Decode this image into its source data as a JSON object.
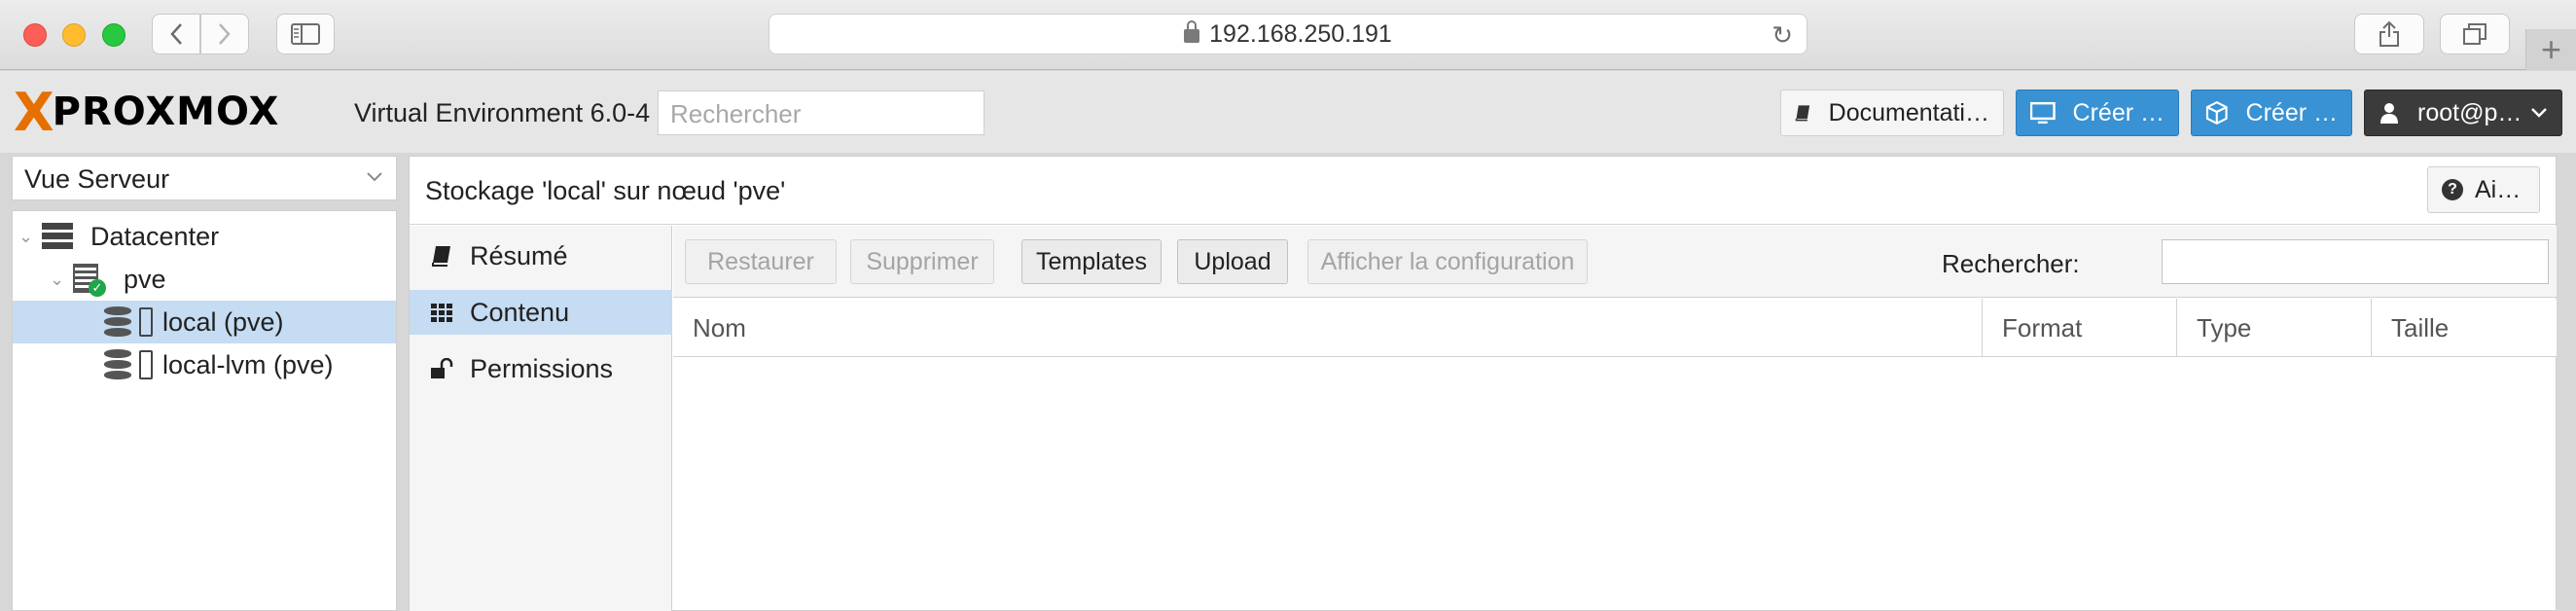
{
  "browser": {
    "url": "192.168.250.191",
    "icons": {
      "back": "chevron-left-icon",
      "forward": "chevron-right-icon",
      "sidebar": "sidebar-icon",
      "reload": "reload-icon",
      "share": "share-icon",
      "tabs": "tabs-icon",
      "new_tab": "plus-icon"
    }
  },
  "header": {
    "logo_prefix": "X",
    "logo_text": "PROXMOX",
    "version": "Virtual Environment 6.0-4",
    "search_placeholder": "Rechercher",
    "buttons": {
      "documentation": "Documentati…",
      "create_vm": "Créer …",
      "create_ct": "Créer …",
      "user": "root@p…"
    }
  },
  "tree": {
    "view_select": "Vue Serveur",
    "nodes": [
      {
        "label": "Datacenter",
        "icon": "datacenter-icon"
      },
      {
        "label": "pve",
        "icon": "node-icon"
      },
      {
        "label": "local (pve)",
        "icon": "storage-icon",
        "selected": true
      },
      {
        "label": "local-lvm (pve)",
        "icon": "storage-icon"
      }
    ]
  },
  "main": {
    "title": "Stockage 'local' sur nœud 'pve'",
    "help_label": "Ai…",
    "subnav": [
      {
        "label": "Résumé",
        "icon": "book-icon"
      },
      {
        "label": "Contenu",
        "icon": "grid-icon",
        "selected": true
      },
      {
        "label": "Permissions",
        "icon": "unlock-icon"
      }
    ],
    "toolbar": {
      "restore": "Restaurer",
      "delete": "Supprimer",
      "templates": "Templates",
      "upload": "Upload",
      "show_config": "Afficher la configuration",
      "search_label": "Rechercher:",
      "search_value": ""
    },
    "columns": [
      "Nom",
      "Format",
      "Type",
      "Taille"
    ]
  },
  "colors": {
    "accent_orange": "#e57000",
    "button_blue": "#3892d4",
    "selection": "#c5dcf3"
  }
}
